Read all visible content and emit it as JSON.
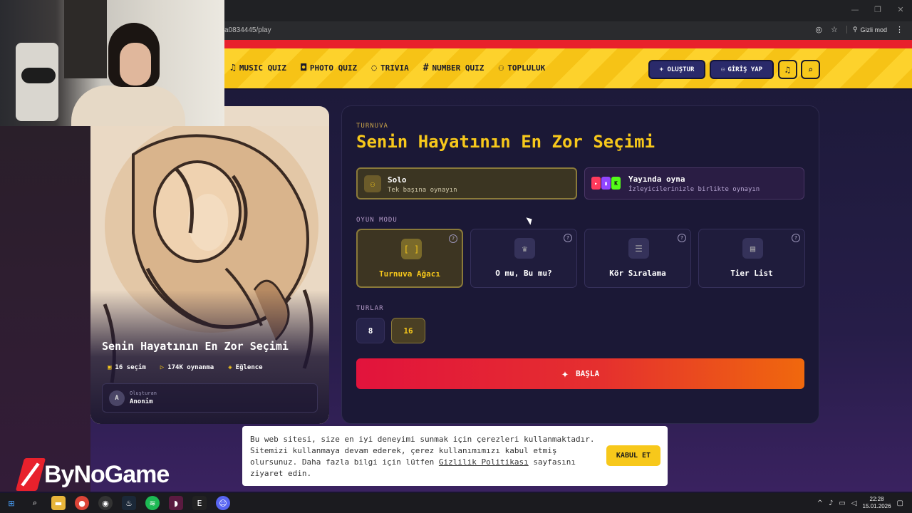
{
  "browser": {
    "url": "a0834445/play",
    "incognito_label": "Gizli mod",
    "window_controls": [
      "—",
      "❐",
      "✕"
    ]
  },
  "nav": {
    "items": [
      {
        "icon": "music-note-icon",
        "glyph": "♫",
        "label": "MUSIC QUIZ"
      },
      {
        "icon": "camera-icon",
        "glyph": "◘",
        "label": "PHOTO QUIZ"
      },
      {
        "icon": "question-bubble-icon",
        "glyph": "◌",
        "label": "TRIVIA"
      },
      {
        "icon": "hash-icon",
        "glyph": "#",
        "label": "NUMBER QUIZ"
      },
      {
        "icon": "users-icon",
        "glyph": "⚇",
        "label": "TOPLULUK"
      }
    ],
    "create_label": "+ OLUŞTUR",
    "login_label": "GİRİŞ YAP"
  },
  "card": {
    "title": "Senin Hayatının En Zor Seçimi",
    "choices": "16 seçim",
    "plays": "174K oynanma",
    "category": "Eğlence",
    "creator_label": "Oluşturan",
    "creator_name": "Anonim",
    "creator_initial": "A"
  },
  "panel": {
    "kicker": "TURNUVA",
    "title": "Senin Hayatının En Zor Seçimi",
    "solo": {
      "title": "Solo",
      "subtitle": "Tek başına oynayın"
    },
    "stream": {
      "title": "Yayında oyna",
      "subtitle": "İzleyicilerinizle birlikte oynayın"
    },
    "mode_label": "OYUN MODU",
    "modes": [
      {
        "icon": "bracket-icon",
        "glyph": "[ ]",
        "label": "Turnuva Ağacı",
        "selected": true
      },
      {
        "icon": "crown-icon",
        "glyph": "♛",
        "label": "O mu, Bu mu?",
        "selected": false
      },
      {
        "icon": "ranked-list-icon",
        "glyph": "☰",
        "label": "Kör Sıralama",
        "selected": false
      },
      {
        "icon": "tier-list-icon",
        "glyph": "▤",
        "label": "Tier List",
        "selected": false
      }
    ],
    "rounds_label": "TURLAR",
    "rounds": [
      "8",
      "16"
    ],
    "selected_round": "16",
    "start_label": "BAŞLA"
  },
  "cookie": {
    "text_before": "Bu web sitesi, size en iyi deneyimi sunmak için çerezleri kullanmaktadır. Sitemizi kullanmaya devam ederek, çerez kullanımımızı kabul etmiş olursunuz. Daha fazla bilgi için lütfen ",
    "link": "Gizlilik Politikası",
    "text_after": " sayfasını ziyaret edin.",
    "accept_label": "KABUL ET"
  },
  "watermark": "ByNoGame",
  "taskbar": {
    "time": "22:28",
    "date": "15.01.2026"
  },
  "colors": {
    "accent_yellow": "#f7c81b",
    "start_red": "#e2133c",
    "start_orange": "#f0680d",
    "panel_bg": "#1b1836"
  }
}
